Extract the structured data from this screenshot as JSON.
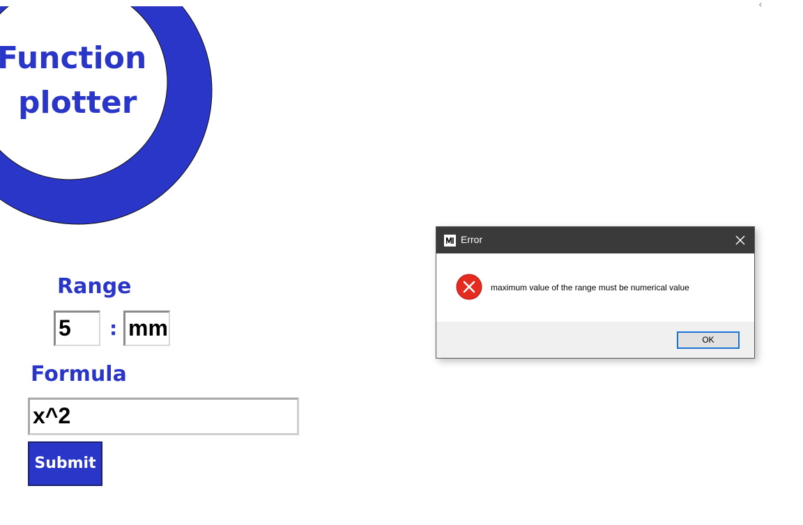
{
  "logo": {
    "line1": "Function",
    "line2": "plotter"
  },
  "range": {
    "label": "Range",
    "min_value": "5",
    "separator": ":",
    "max_value": "mm"
  },
  "formula": {
    "label": "Formula",
    "value": "x^2"
  },
  "submit": {
    "label": "Submit"
  },
  "dialog": {
    "title": "Error",
    "message": "maximum value of the range must be numerical value",
    "ok_label": "OK"
  },
  "colors": {
    "brand_blue": "#2a36c8",
    "titlebar": "#3a3a3a",
    "error_red": "#e52b1f",
    "ok_border": "#1a72d6"
  },
  "icons": {
    "logo": "crescent-ring-icon",
    "app": "app-icon",
    "close": "close-icon",
    "error": "error-icon",
    "window_corner": "chevron-left-icon"
  }
}
